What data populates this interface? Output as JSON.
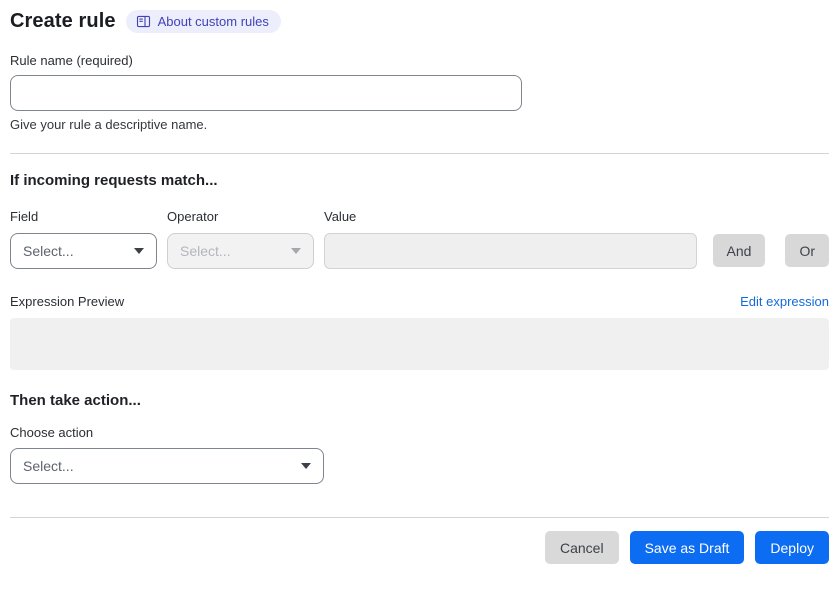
{
  "page": {
    "title": "Create rule",
    "about_badge_label": "About custom rules"
  },
  "rule_name": {
    "label": "Rule name (required)",
    "value": "",
    "helper": "Give your rule a descriptive name."
  },
  "match_section": {
    "heading": "If incoming requests match...",
    "field": {
      "label": "Field",
      "selected": "Select..."
    },
    "operator": {
      "label": "Operator",
      "selected": "Select..."
    },
    "value": {
      "label": "Value",
      "value": ""
    },
    "and_label": "And",
    "or_label": "Or"
  },
  "expression": {
    "label": "Expression Preview",
    "edit_link": "Edit expression",
    "content": ""
  },
  "action_section": {
    "heading": "Then take action...",
    "choose_label": "Choose action",
    "selected": "Select..."
  },
  "footer": {
    "cancel": "Cancel",
    "save_draft": "Save as Draft",
    "deploy": "Deploy"
  },
  "icons": {
    "badge_icon": "book-icon",
    "select_icon": "chevron-down-icon"
  },
  "colors": {
    "primary_blue": "#0c6cf2",
    "link_blue": "#136bdc",
    "badge_bg": "#eceefb",
    "badge_text": "#4341b8",
    "disabled_bg": "#f2f2f3",
    "gray_button_bg": "#d9d9da"
  }
}
